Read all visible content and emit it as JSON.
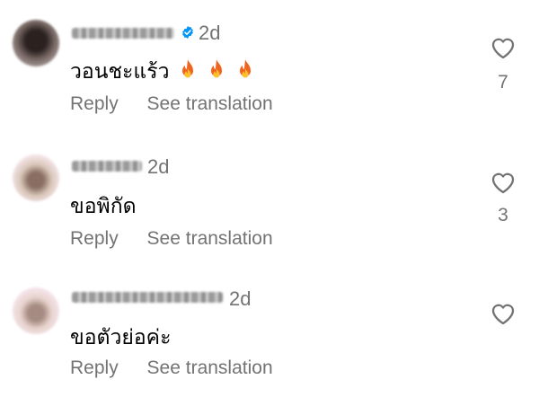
{
  "comments": [
    {
      "time": "2d",
      "text": "วอนชะแร้ว",
      "emoji": [
        "fire-icon",
        "fire-icon",
        "fire-icon"
      ],
      "verified": true,
      "reply_label": "Reply",
      "translate_label": "See translation",
      "likes": "7"
    },
    {
      "time": "2d",
      "text": "ขอพิกัด",
      "verified": false,
      "reply_label": "Reply",
      "translate_label": "See translation",
      "likes": "3"
    },
    {
      "time": "2d",
      "text": "ขอตัวย่อค่ะ",
      "verified": false,
      "reply_label": "Reply",
      "translate_label": "See translation",
      "likes": ""
    }
  ],
  "colors": {
    "secondary_text": "#737373",
    "verified_blue": "#0095f6"
  }
}
